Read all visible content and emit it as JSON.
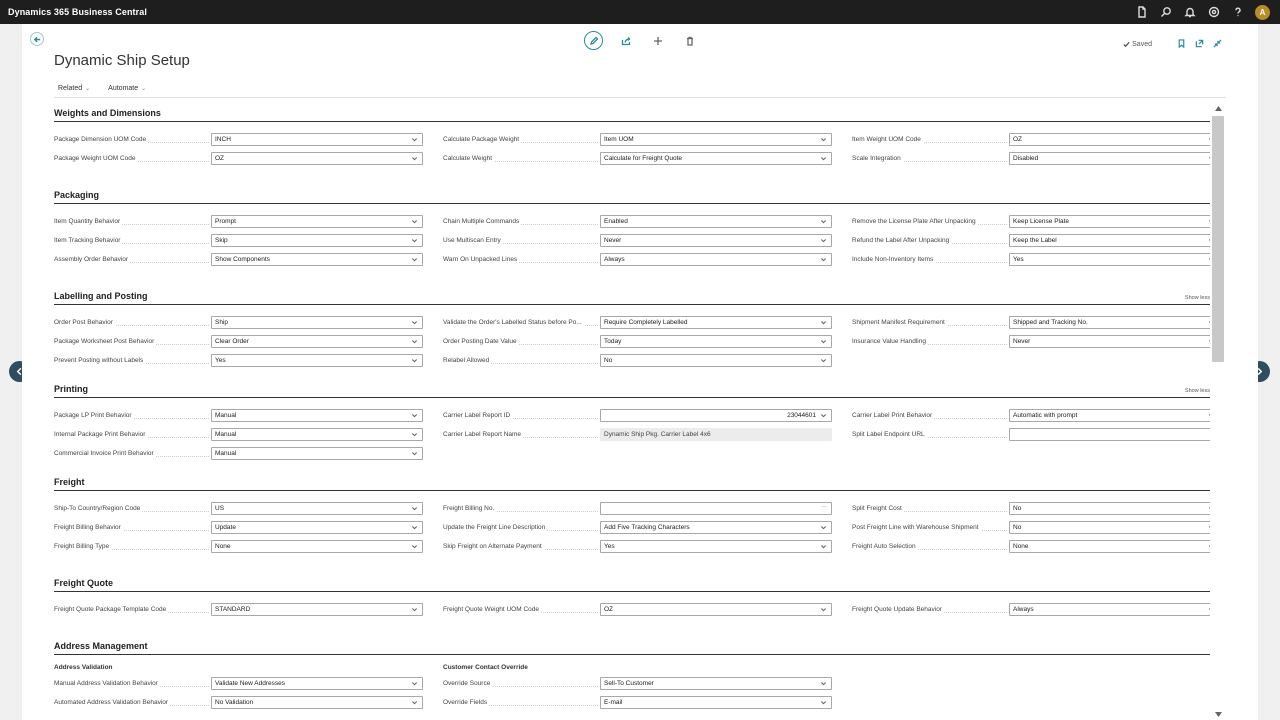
{
  "app": {
    "title": "Dynamics 365 Business Central",
    "avatar_initial": "A"
  },
  "page": {
    "title": "Dynamic Ship Setup",
    "saved_label": "Saved",
    "menu": [
      {
        "label": "Related"
      },
      {
        "label": "Automate"
      }
    ]
  },
  "icons": {
    "top": [
      "document-icon",
      "search-icon",
      "bell-icon",
      "settings-icon",
      "help-icon"
    ],
    "actions": [
      "edit-icon",
      "share-icon",
      "new-icon",
      "delete-icon"
    ]
  },
  "sections": {
    "weights": {
      "title": "Weights and Dimensions",
      "cols": [
        [
          {
            "label": "Package Dimension UOM Code",
            "value": "INCH"
          },
          {
            "label": "Package Weight UOM Code",
            "value": "OZ"
          }
        ],
        [
          {
            "label": "Calculate Package Weight",
            "value": "Item UOM"
          },
          {
            "label": "Calculate Weight",
            "value": "Calculate for Freight Quote"
          }
        ],
        [
          {
            "label": "Item Weight UOM Code",
            "value": "OZ"
          },
          {
            "label": "Scale Integration",
            "value": "Disabled"
          }
        ]
      ]
    },
    "packaging": {
      "title": "Packaging",
      "cols": [
        [
          {
            "label": "Item Quantity Behavior",
            "value": "Prompt"
          },
          {
            "label": "Item Tracking Behavior",
            "value": "Skip"
          },
          {
            "label": "Assembly Order Behavior",
            "value": "Show Components"
          }
        ],
        [
          {
            "label": "Chain Multiple Commands",
            "value": "Enabled"
          },
          {
            "label": "Use Multiscan Entry",
            "value": "Never"
          },
          {
            "label": "Warn On Unpacked Lines",
            "value": "Always"
          }
        ],
        [
          {
            "label": "Remove the License Plate After Unpacking",
            "value": "Keep License Plate"
          },
          {
            "label": "Refund the Label After Unpacking",
            "value": "Keep the Label"
          },
          {
            "label": "Include Non-Inventory Items",
            "value": "Yes"
          }
        ]
      ]
    },
    "labelling": {
      "title": "Labelling and Posting",
      "show_less": "Show less",
      "cols": [
        [
          {
            "label": "Order Post Behavior",
            "value": "Ship"
          },
          {
            "label": "Package Worksheet Post Behavior",
            "value": "Clear Order"
          },
          {
            "label": "Prevent Posting without Labels",
            "value": "Yes"
          }
        ],
        [
          {
            "label": "Validate the Order's Labelled Status before Po...",
            "value": "Require Completely Labelled"
          },
          {
            "label": "Order Posting Date Value",
            "value": "Today"
          },
          {
            "label": "Relabel Allowed",
            "value": "No"
          }
        ],
        [
          {
            "label": "Shipment Manifest Requirement",
            "value": "Shipped and Tracking No."
          },
          {
            "label": "Insurance Value Handling",
            "value": "Never"
          }
        ]
      ]
    },
    "printing": {
      "title": "Printing",
      "show_less": "Show less",
      "cols": [
        [
          {
            "label": "Package LP Print Behavior",
            "value": "Manual"
          },
          {
            "label": "Internal Package Print Behavior",
            "value": "Manual"
          },
          {
            "label": "Commercial Invoice Print Behavior",
            "value": "Manual"
          }
        ],
        [
          {
            "label": "Carrier Label Report ID",
            "value": "23044601"
          },
          {
            "label": "Carrier Label Report Name",
            "value": "Dynamic Ship Pkg. Carrier Label 4x6"
          }
        ],
        [
          {
            "label": "Carrier Label Print Behavior",
            "value": "Automatic with prompt"
          },
          {
            "label": "Split Label Endpoint URL",
            "value": ""
          }
        ]
      ]
    },
    "freight": {
      "title": "Freight",
      "cols": [
        [
          {
            "label": "Ship-To Country/Region Code",
            "value": "US"
          },
          {
            "label": "Freight Billing Behavior",
            "value": "Update"
          },
          {
            "label": "Freight Billing Type",
            "value": "None"
          }
        ],
        [
          {
            "label": "Freight Billing No.",
            "value": ""
          },
          {
            "label": "Update the Freight Line Description",
            "value": "Add Five Tracking Characters"
          },
          {
            "label": "Skip Freight on Alternate Payment",
            "value": "Yes"
          }
        ],
        [
          {
            "label": "Split Freight Cost",
            "value": "No"
          },
          {
            "label": "Post Freight Line with Warehouse Shipment",
            "value": "No"
          },
          {
            "label": "Freight Auto Selection",
            "value": "None"
          }
        ]
      ]
    },
    "freight_quote": {
      "title": "Freight Quote",
      "cols": [
        [
          {
            "label": "Freight Quote Package Template Code",
            "value": "STANDARD"
          }
        ],
        [
          {
            "label": "Freight Quote Weight UOM Code",
            "value": "OZ"
          }
        ],
        [
          {
            "label": "Freight Quote Update Behavior",
            "value": "Always"
          }
        ]
      ]
    },
    "address": {
      "title": "Address Management",
      "sub1": "Address Validation",
      "sub2": "Customer Contact Override",
      "cols": [
        [
          {
            "label": "Manual Address Validation Behavior",
            "value": "Validate New Addresses"
          },
          {
            "label": "Automated Address Validation Behavior",
            "value": "No Validation"
          }
        ],
        [
          {
            "label": "Override Source",
            "value": "Sell-To Customer"
          },
          {
            "label": "Override Fields",
            "value": "E-mail"
          }
        ]
      ]
    }
  }
}
